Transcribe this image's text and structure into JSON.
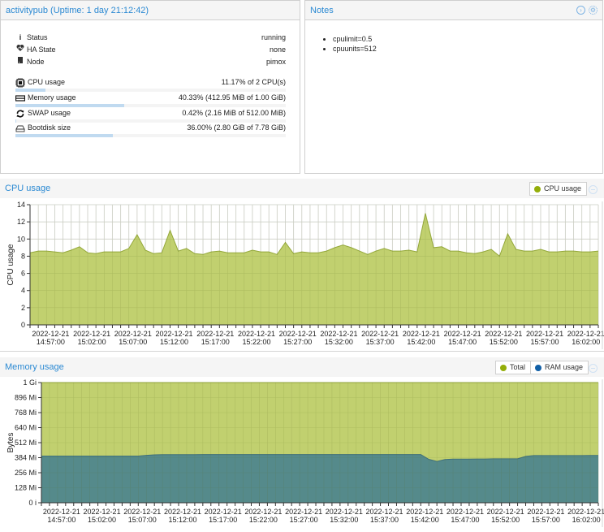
{
  "status_panel": {
    "title": "activitypub (Uptime: 1 day 21:12:42)",
    "rows": [
      {
        "icon": "info-icon",
        "label": "Status",
        "value": "running"
      },
      {
        "icon": "heartbeat-icon",
        "label": "HA State",
        "value": "none"
      },
      {
        "icon": "server-icon",
        "label": "Node",
        "value": "pimox"
      }
    ],
    "meters": [
      {
        "icon": "cpu-chip-icon",
        "label": "CPU usage",
        "value": "11.17% of 2 CPU(s)",
        "fraction": 0.1117
      },
      {
        "icon": "memory-icon",
        "label": "Memory usage",
        "value": "40.33% (412.95 MiB of 1.00 GiB)",
        "fraction": 0.4033
      },
      {
        "icon": "refresh-swap-icon",
        "label": "SWAP usage",
        "value": "0.42% (2.16 MiB of 512.00 MiB)",
        "fraction": 0.0042
      },
      {
        "icon": "hdd-icon",
        "label": "Bootdisk size",
        "value": "36.00% (2.80 GiB of 7.78 GiB)",
        "fraction": 0.36
      }
    ]
  },
  "notes_panel": {
    "title": "Notes",
    "items": [
      "cpulimit=0.5",
      "cpuunits=512"
    ],
    "icons": [
      "expand-circle-icon",
      "gear-icon"
    ]
  },
  "colors": {
    "accent": "#2c8ad3",
    "cpu_fill": "#c1d06f",
    "cpu_line": "#94a83a",
    "total_fill": "#c1d06f",
    "ram_fill": "#558a8b",
    "ram_line": "#3f6f7a",
    "legend_green": "#94ae0a",
    "legend_blue": "#115fa6"
  },
  "chart_data": [
    {
      "type": "area",
      "title": "CPU usage",
      "ylabel": "CPU usage",
      "xlabel": "",
      "ylim": [
        0,
        14
      ],
      "yticks": [
        0,
        2,
        4,
        6,
        8,
        10,
        12,
        14
      ],
      "grid": true,
      "legend": [
        "CPU usage"
      ],
      "legend_position": "top-right",
      "x_start": "14:54:30",
      "x_step_minutes": 1,
      "x_ticks": [
        {
          "date": "2022-12-21",
          "time": "14:57:00"
        },
        {
          "date": "2022-12-21",
          "time": "15:02:00"
        },
        {
          "date": "2022-12-21",
          "time": "15:07:00"
        },
        {
          "date": "2022-12-21",
          "time": "15:12:00"
        },
        {
          "date": "2022-12-21",
          "time": "15:17:00"
        },
        {
          "date": "2022-12-21",
          "time": "15:22:00"
        },
        {
          "date": "2022-12-21",
          "time": "15:27:00"
        },
        {
          "date": "2022-12-21",
          "time": "15:32:00"
        },
        {
          "date": "2022-12-21",
          "time": "15:37:00"
        },
        {
          "date": "2022-12-21",
          "time": "15:42:00"
        },
        {
          "date": "2022-12-21",
          "time": "15:47:00"
        },
        {
          "date": "2022-12-21",
          "time": "15:52:00"
        },
        {
          "date": "2022-12-21",
          "time": "15:57:00"
        },
        {
          "date": "2022-12-21",
          "time": "16:02:00"
        }
      ],
      "series": [
        {
          "name": "CPU usage",
          "values": [
            8.4,
            8.6,
            8.6,
            8.5,
            8.4,
            8.7,
            9.1,
            8.4,
            8.3,
            8.5,
            8.5,
            8.5,
            8.9,
            10.5,
            8.7,
            8.3,
            8.4,
            11.0,
            8.6,
            8.9,
            8.3,
            8.2,
            8.5,
            8.6,
            8.4,
            8.4,
            8.4,
            8.7,
            8.5,
            8.5,
            8.2,
            9.6,
            8.3,
            8.5,
            8.4,
            8.4,
            8.6,
            9.0,
            9.3,
            9.0,
            8.6,
            8.2,
            8.6,
            8.9,
            8.6,
            8.6,
            8.7,
            8.5,
            13.0,
            9.0,
            9.1,
            8.6,
            8.6,
            8.4,
            8.3,
            8.5,
            8.8,
            8.0,
            10.6,
            8.8,
            8.6,
            8.6,
            8.8,
            8.5,
            8.5,
            8.6,
            8.6,
            8.5,
            8.5,
            8.6
          ]
        }
      ]
    },
    {
      "type": "area",
      "title": "Memory usage",
      "ylabel": "Bytes",
      "xlabel": "",
      "ylim_mib": [
        0,
        1024
      ],
      "yticks": [
        "0 i",
        "128 Mi",
        "256 Mi",
        "384 Mi",
        "512 Mi",
        "640 Mi",
        "768 Mi",
        "896 Mi",
        "1 Gi"
      ],
      "ytick_values_mib": [
        0,
        128,
        256,
        384,
        512,
        640,
        768,
        896,
        1024
      ],
      "grid": true,
      "legend": [
        "Total",
        "RAM usage"
      ],
      "legend_position": "top-right",
      "x_start": "14:54:30",
      "x_step_minutes": 1,
      "series": [
        {
          "name": "Total",
          "unit": "MiB",
          "values": "constant 1024"
        },
        {
          "name": "RAM usage",
          "unit": "MiB",
          "values": [
            398,
            398,
            398,
            398,
            398,
            398,
            398,
            398,
            398,
            398,
            398,
            398,
            398,
            404,
            408,
            410,
            410,
            410,
            410,
            410,
            411,
            411,
            411,
            411,
            411,
            411,
            411,
            411,
            411,
            411,
            411,
            411,
            411,
            411,
            411,
            411,
            411,
            411,
            411,
            411,
            411,
            411,
            411,
            411,
            411,
            411,
            411,
            411,
            370,
            352,
            368,
            372,
            372,
            372,
            373,
            373,
            374,
            374,
            374,
            374,
            395,
            402,
            402,
            402,
            402,
            402,
            402,
            402,
            403,
            403
          ]
        }
      ]
    }
  ]
}
